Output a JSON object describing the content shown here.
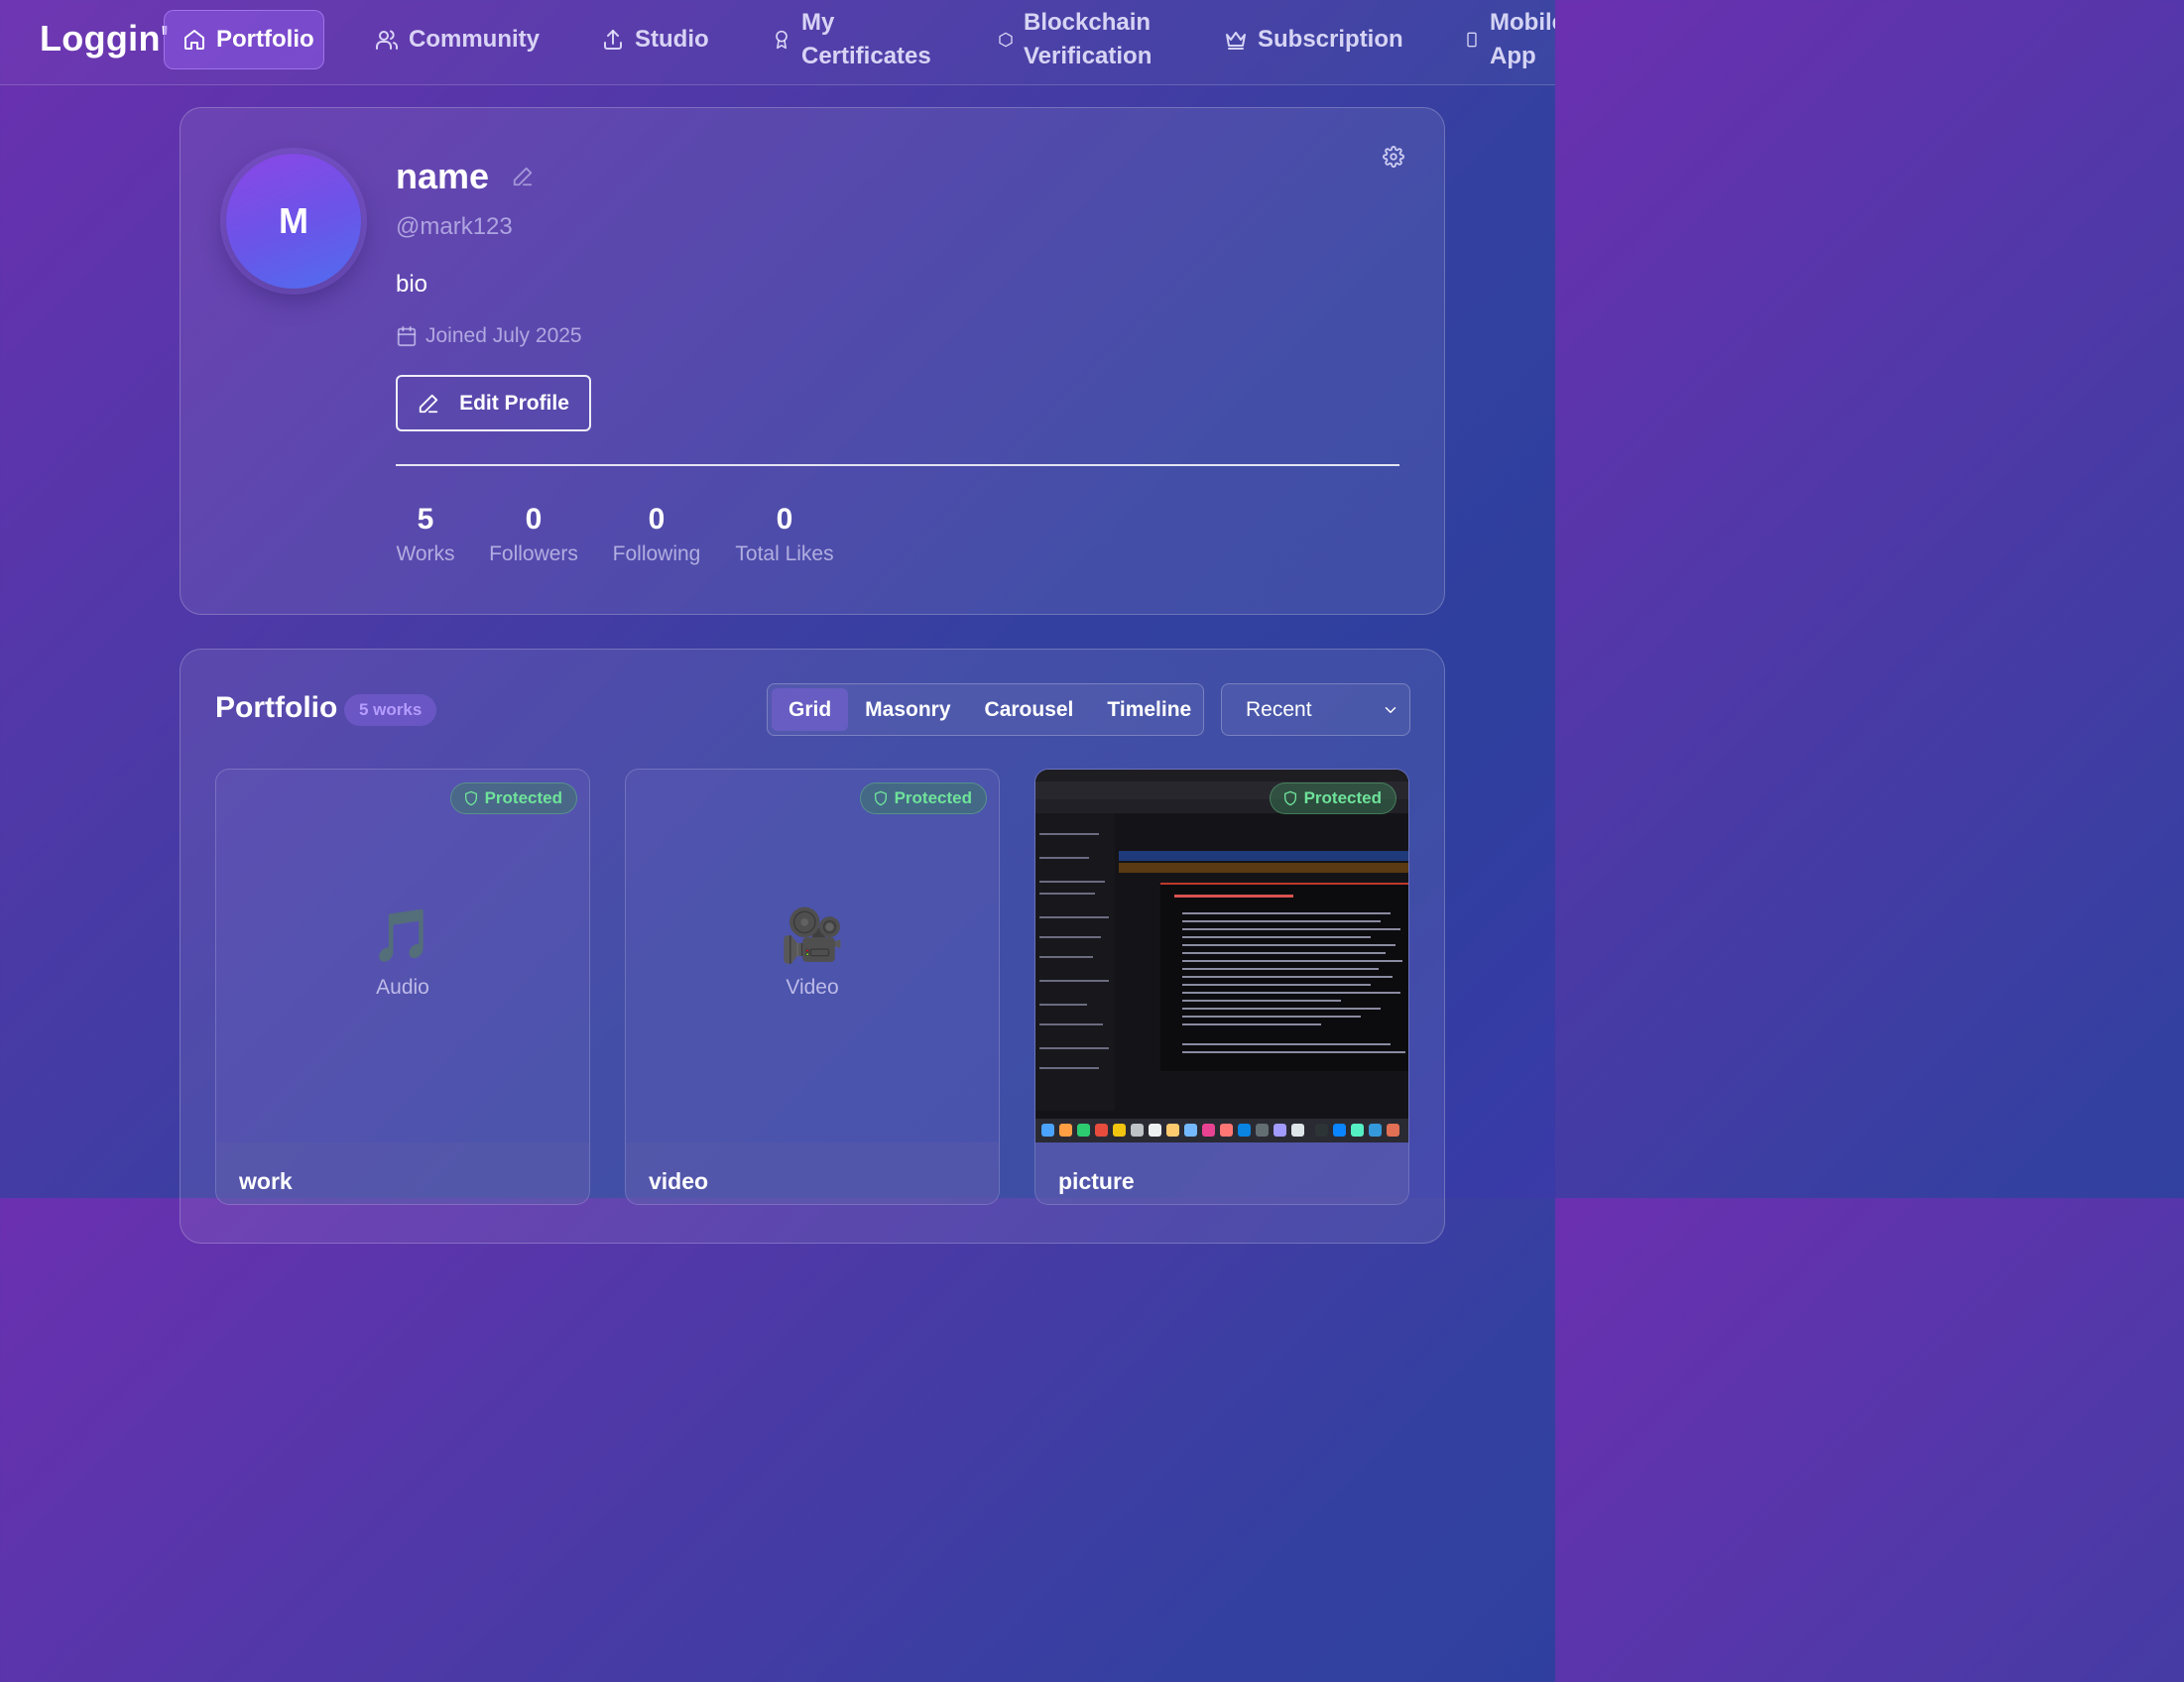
{
  "nav": {
    "brand": "Loggin'",
    "items": [
      {
        "label": "Portfolio",
        "icon": "home-icon",
        "active": true
      },
      {
        "label": "Community",
        "icon": "users-icon",
        "active": false
      },
      {
        "label": "Studio",
        "icon": "upload-icon",
        "active": false
      },
      {
        "label": "My Certificates",
        "icon": "award-icon",
        "active": false
      },
      {
        "label": "Blockchain Verification",
        "icon": "hexagon-icon",
        "active": false
      },
      {
        "label": "Subscription",
        "icon": "crown-icon",
        "active": false
      },
      {
        "label": "Mobile App",
        "icon": "smartphone-icon",
        "active": false
      }
    ]
  },
  "profile": {
    "avatar_initial": "M",
    "name": "name",
    "handle": "@mark123",
    "bio": "bio",
    "joined": "Joined July 2025",
    "edit_button": "Edit Profile",
    "stats": [
      {
        "value": "5",
        "label": "Works"
      },
      {
        "value": "0",
        "label": "Followers"
      },
      {
        "value": "0",
        "label": "Following"
      },
      {
        "value": "0",
        "label": "Total Likes"
      }
    ]
  },
  "portfolio": {
    "title": "Portfolio",
    "count_badge": "5 works",
    "views": [
      "Grid",
      "Masonry",
      "Carousel",
      "Timeline"
    ],
    "active_view": "Grid",
    "sort": {
      "selected": "Recent"
    },
    "works": [
      {
        "title": "work",
        "type_label": "Audio",
        "icon": "music-note-icon",
        "glyph": "🎵",
        "badge": "Protected"
      },
      {
        "title": "video",
        "type_label": "Video",
        "icon": "video-camera-icon",
        "glyph": "🎥",
        "badge": "Protected"
      },
      {
        "title": "picture",
        "type_label": "",
        "icon": "screenshot-thumbnail",
        "glyph": "",
        "badge": "Protected"
      }
    ]
  },
  "colors": {
    "accent_purple": "#8b46e6",
    "protected_green": "#6fe39a",
    "badge_purple": "#b59cff"
  }
}
